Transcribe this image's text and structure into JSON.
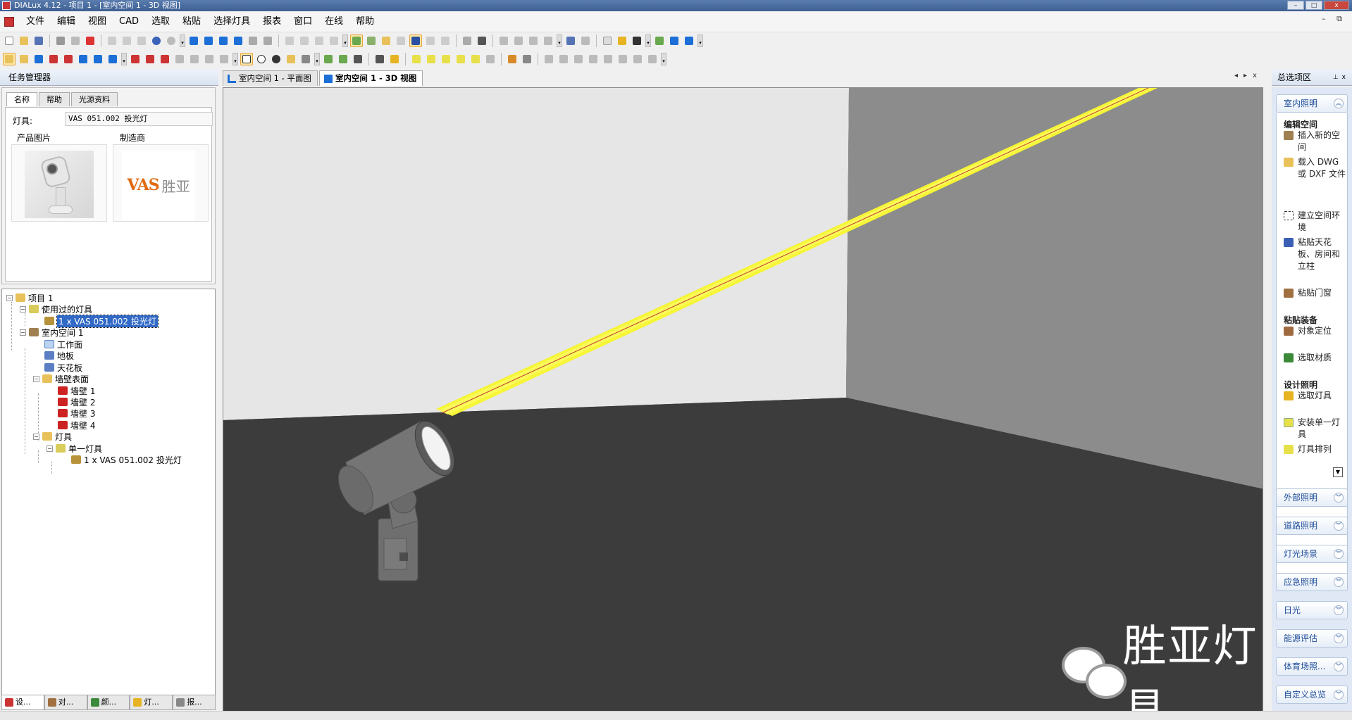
{
  "window": {
    "title": "DIALux 4.12 - 项目 1 - [室内空间 1 - 3D 视图]",
    "controls": [
      "–",
      "□",
      "x"
    ]
  },
  "menu": {
    "items": [
      "文件",
      "编辑",
      "视图",
      "CAD",
      "选取",
      "粘贴",
      "选择灯具",
      "报表",
      "窗口",
      "在线",
      "帮助"
    ]
  },
  "task_manager": {
    "title": "任务管理器",
    "tabs": [
      "名称",
      "帮助",
      "光源资料"
    ],
    "luminaire_label": "灯具:",
    "luminaire_value": "VAS 051.002 投光灯",
    "product_image_label": "产品图片",
    "manufacturer_label": "制造商",
    "manufacturer_logo_text": "VAS",
    "manufacturer_logo_cn": "胜亚"
  },
  "tree": {
    "project": "项目 1",
    "used_luminaires": "使用过的灯具",
    "used_luminaire_item": "1 x VAS 051.002 投光灯",
    "room": "室内空间 1",
    "workplane": "工作面",
    "floor": "地板",
    "ceiling": "天花板",
    "walls": "墙壁表面",
    "wall_1": "墙壁 1",
    "wall_2": "墙壁 2",
    "wall_3": "墙壁 3",
    "wall_4": "墙壁 4",
    "luminaires": "灯具",
    "single_luminaire": "单一灯具",
    "luminaire_item": "1 x VAS 051.002 投光灯"
  },
  "bottom_tabs": [
    "设...",
    "对...",
    "颜...",
    "灯...",
    "报..."
  ],
  "doc_tabs": {
    "plan": "室内空间 1 - 平面图",
    "view3d": "室内空间 1 - 3D 视图"
  },
  "watermark": {
    "text": "胜亚灯具"
  },
  "explorer": {
    "title": "总选项区",
    "interior": "室内照明",
    "edit_room": "编辑空间",
    "insert_room": "插入新的空间",
    "load_dwg": "载入 DWG 或 DXF 文件",
    "build_env": "建立空间环境",
    "paste_ceiling": "粘贴天花板、房间和立柱",
    "paste_door": "粘贴门窗",
    "paste_furniture": "粘贴装备",
    "object_position": "对象定位",
    "select_material": "选取材质",
    "design_lighting": "设计照明",
    "select_luminaire": "选取灯具",
    "install_single": "安装单一灯具",
    "luminaire_array": "灯具排列",
    "exterior": "外部照明",
    "street": "道路照明",
    "light_scenes": "灯光场景",
    "emergency": "应急照明",
    "daylight": "日光",
    "energy": "能源评估",
    "sports": "体育场照...",
    "custom": "自定义总览"
  },
  "colors": {
    "beam": "#f6f536",
    "beam_axis": "#c0392b",
    "back_wall": "#e6e6e6",
    "side_wall": "#8c8c8c",
    "floor": "#3c3c3c",
    "selection": "#3169c6"
  }
}
